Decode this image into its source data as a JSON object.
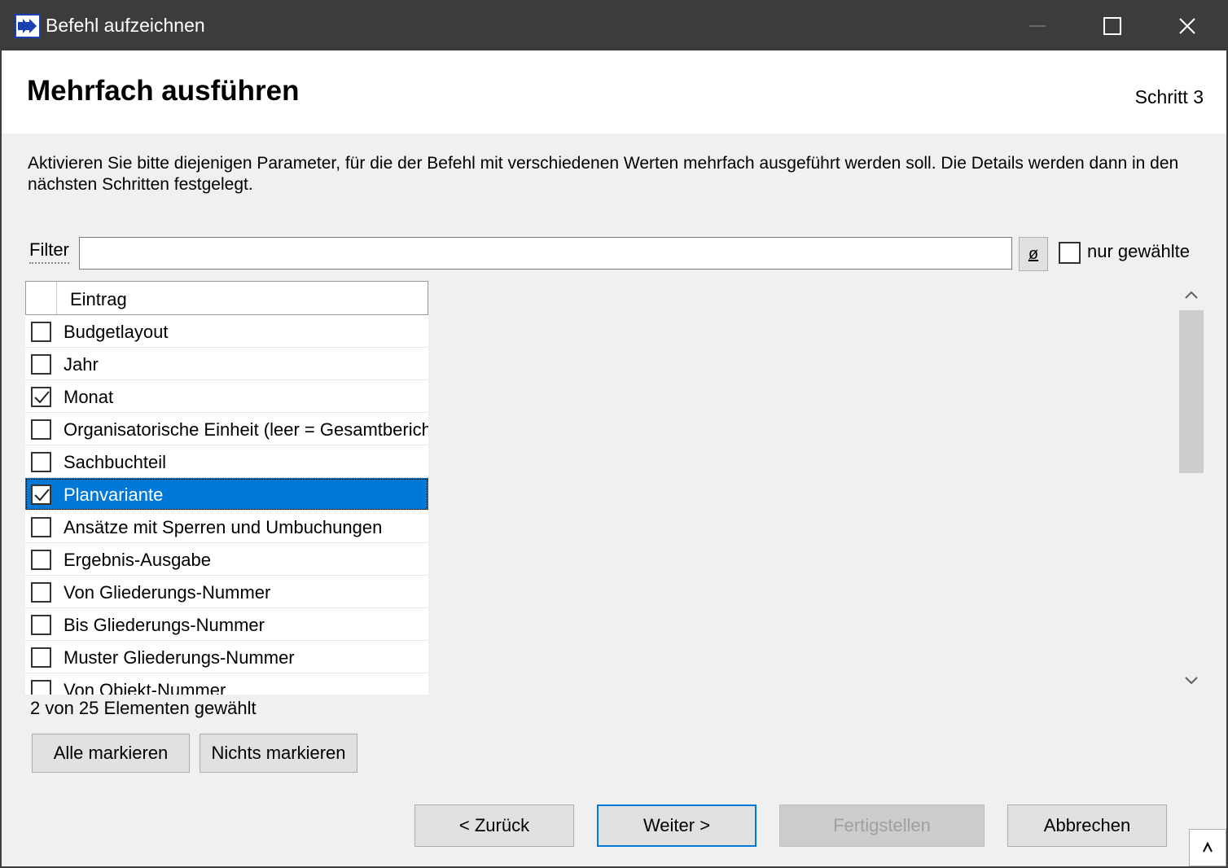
{
  "window": {
    "title": "Befehl aufzeichnen",
    "minimize_icon": "minimize-icon",
    "maximize_icon": "maximize-icon",
    "close_icon": "close-icon"
  },
  "header": {
    "title": "Mehrfach ausführen",
    "step": "Schritt 3"
  },
  "description": "Aktivieren Sie bitte diejenigen Parameter, für die der Befehl mit verschiedenen Werten mehrfach ausgeführt werden soll. Die Details werden dann in den nächsten Schritten festgelegt.",
  "filter": {
    "label": "Filter",
    "value": "",
    "clear_label": "ø",
    "only_selected_label": "nur gewählte",
    "only_selected_checked": false
  },
  "list": {
    "column_header": "Eintrag",
    "rows": [
      {
        "label": "Budgetlayout",
        "checked": false,
        "selected": false
      },
      {
        "label": "Jahr",
        "checked": false,
        "selected": false
      },
      {
        "label": "Monat",
        "checked": true,
        "selected": false
      },
      {
        "label": "Organisatorische Einheit (leer = Gesamtbericht)",
        "checked": false,
        "selected": false
      },
      {
        "label": "Sachbuchteil",
        "checked": false,
        "selected": false
      },
      {
        "label": "Planvariante",
        "checked": true,
        "selected": true
      },
      {
        "label": "Ansätze mit Sperren und Umbuchungen",
        "checked": false,
        "selected": false
      },
      {
        "label": "Ergebnis-Ausgabe",
        "checked": false,
        "selected": false
      },
      {
        "label": "Von Gliederungs-Nummer",
        "checked": false,
        "selected": false
      },
      {
        "label": "Bis Gliederungs-Nummer",
        "checked": false,
        "selected": false
      },
      {
        "label": "Muster Gliederungs-Nummer",
        "checked": false,
        "selected": false
      },
      {
        "label": "Von Objekt-Nummer",
        "checked": false,
        "selected": false
      }
    ]
  },
  "status": {
    "count_text": "2 von 25 Elementen gewählt"
  },
  "buttons": {
    "select_all": "Alle markieren",
    "select_none": "Nichts markieren",
    "back": "< Zurück",
    "next": "Weiter >",
    "finish": "Fertigstellen",
    "cancel": "Abbrechen"
  },
  "colors": {
    "titlebar": "#3c3c3c",
    "selection": "#0078d7",
    "default_button_border": "#0078d7"
  }
}
